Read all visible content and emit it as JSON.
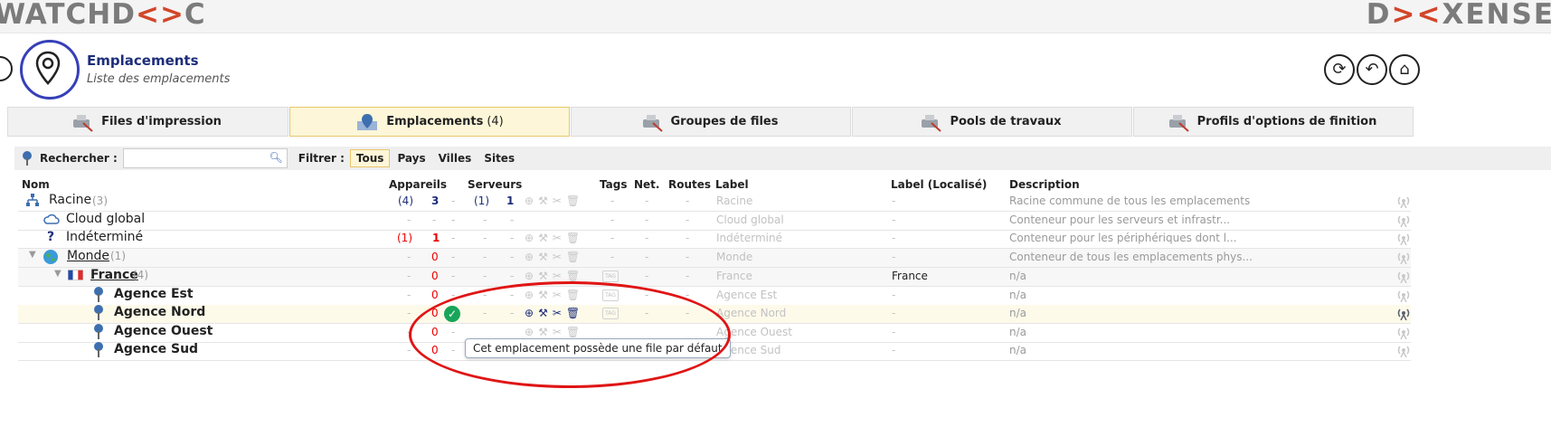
{
  "brand": {
    "left_logo": [
      "WATCHD",
      "<>",
      "C"
    ],
    "right_logo": [
      "D",
      "><",
      "XENSE"
    ]
  },
  "header": {
    "title": "Emplacements",
    "subtitle": "Liste des emplacements"
  },
  "tabs": [
    {
      "label": "Files d'impression",
      "count": ""
    },
    {
      "label": "Emplacements",
      "count": "(4)"
    },
    {
      "label": "Groupes de files",
      "count": ""
    },
    {
      "label": "Pools de travaux",
      "count": ""
    },
    {
      "label": "Profils d'options de finition",
      "count": ""
    }
  ],
  "search": {
    "label": "Rechercher :",
    "value": "",
    "placeholder": ""
  },
  "filter": {
    "label": "Filtrer :",
    "options": [
      "Tous",
      "Pays",
      "Villes",
      "Sites"
    ],
    "selected": "Tous"
  },
  "columns": {
    "nom": "Nom",
    "appareils": "Appareils",
    "serveurs": "Serveurs",
    "tags": "Tags",
    "net": "Net.",
    "routes": "Routes",
    "label": "Label",
    "label_loc": "Label (Localisé)",
    "description": "Description"
  },
  "rows": [
    {
      "name": "Racine",
      "count": "(3)",
      "app_paren": "(4)",
      "app_val": "3",
      "srv_paren": "(1)",
      "srv_val": "1",
      "tags": "-",
      "net": "-",
      "routes": "-",
      "label": "Racine",
      "label_loc": "-",
      "description": "Racine commune de tous les emplacements"
    },
    {
      "name": "Cloud global",
      "count": "",
      "app_paren": "-",
      "app_val": "-",
      "srv_paren": "-",
      "srv_val": "-",
      "tags": "-",
      "net": "-",
      "routes": "-",
      "label": "Cloud global",
      "label_loc": "-",
      "description": "Conteneur pour les serveurs et infrastr..."
    },
    {
      "name": "Indéterminé",
      "count": "",
      "app_paren": "(1)",
      "app_val": "1",
      "srv_paren": "-",
      "srv_val": "-",
      "tags": "-",
      "net": "-",
      "routes": "-",
      "label": "Indéterminé",
      "label_loc": "-",
      "description": "Conteneur pour les périphériques dont l..."
    },
    {
      "name": "Monde",
      "count": "(1)",
      "app_paren": "-",
      "app_val": "0",
      "srv_paren": "-",
      "srv_val": "-",
      "tags": "-",
      "net": "-",
      "routes": "-",
      "label": "Monde",
      "label_loc": "-",
      "description": "Conteneur de tous les emplacements phys..."
    },
    {
      "name": "France",
      "count": "(4)",
      "app_paren": "-",
      "app_val": "0",
      "srv_paren": "-",
      "srv_val": "-",
      "tags": "-",
      "net": "-",
      "routes": "-",
      "label": "France",
      "label_loc": "France",
      "description": "n/a"
    },
    {
      "name": "Agence Est",
      "count": "",
      "app_paren": "-",
      "app_val": "0",
      "srv_paren": "-",
      "srv_val": "-",
      "tags": "-",
      "net": "-",
      "routes": "-",
      "label": "Agence Est",
      "label_loc": "-",
      "description": "n/a"
    },
    {
      "name": "Agence Nord",
      "count": "",
      "app_paren": "-",
      "app_val": "0",
      "srv_paren": "-",
      "srv_val": "-",
      "tags": "-",
      "net": "-",
      "routes": "-",
      "label": "Agence Nord",
      "label_loc": "-",
      "description": "n/a"
    },
    {
      "name": "Agence Ouest",
      "count": "",
      "app_paren": "-",
      "app_val": "0",
      "srv_paren": "-",
      "srv_val": "-",
      "tags": "-",
      "net": "-",
      "routes": "-",
      "label": "Agence Ouest",
      "label_loc": "-",
      "description": "n/a"
    },
    {
      "name": "Agence Sud",
      "count": "",
      "app_paren": "-",
      "app_val": "0",
      "srv_paren": "-",
      "srv_val": "-",
      "tags": "-",
      "net": "-",
      "routes": "-",
      "label": "Agence Sud",
      "label_loc": "-",
      "description": "n/a"
    }
  ],
  "tooltip": "Cet emplacement possède une file par défaut",
  "colors": {
    "accent": "#1d2e7a",
    "highlight": "#fdf6d8",
    "annotation": "#e01515",
    "ok": "#18a55a"
  },
  "icons": [
    "pin-icon",
    "refresh-icon",
    "undo-icon",
    "home-icon",
    "search-icon",
    "network-icon",
    "cloud-icon",
    "question-icon",
    "globe-icon",
    "flag-icon",
    "location-pin-icon",
    "add-icon",
    "tools-icon",
    "cut-icon",
    "trash-icon",
    "tag-icon",
    "antenna-icon",
    "check-icon"
  ]
}
